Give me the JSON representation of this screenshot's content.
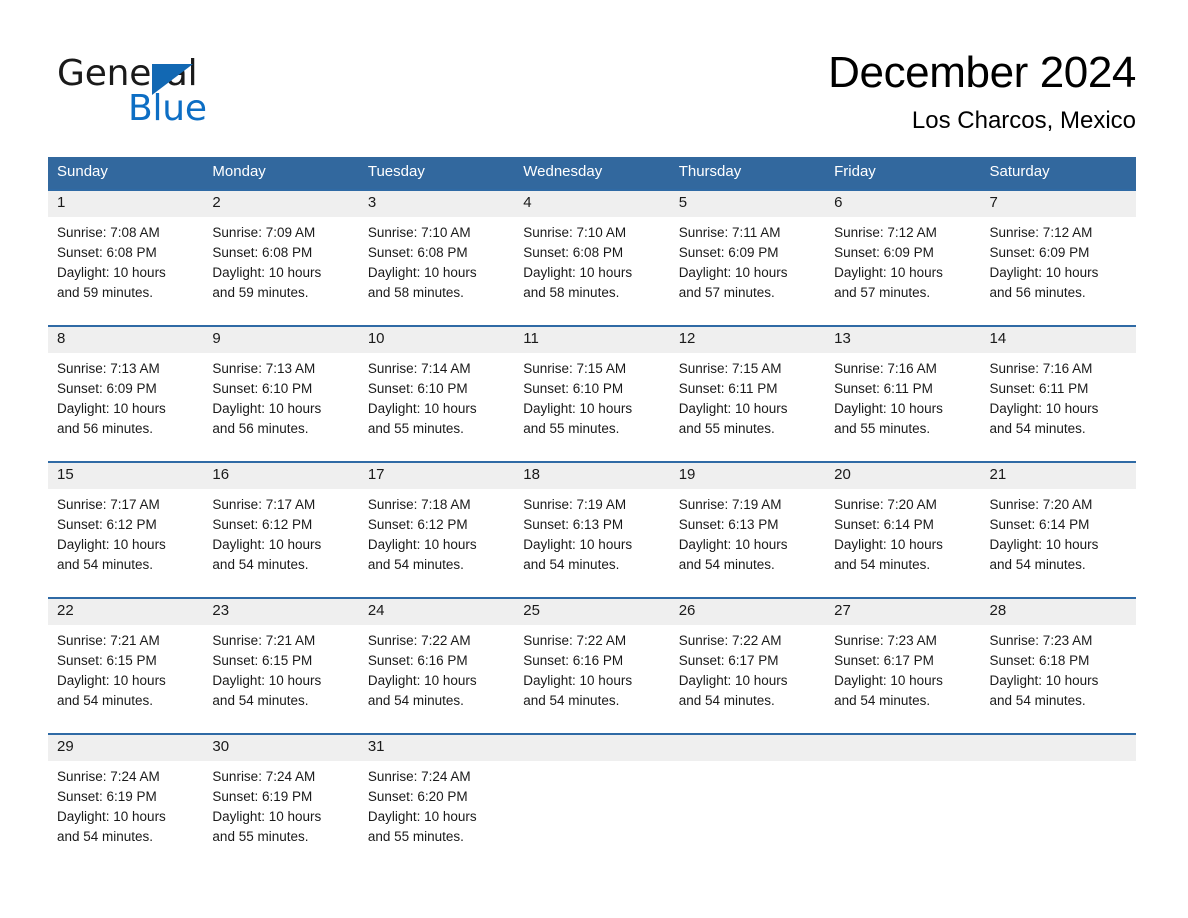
{
  "brand": {
    "name_part1": "General",
    "name_part2": "Blue",
    "triangle_color": "#1268b3",
    "blue_color": "#0d6ec4"
  },
  "header": {
    "month_title": "December 2024",
    "location": "Los Charcos, Mexico"
  },
  "theme": {
    "header_bg": "#32689e",
    "header_text": "#ffffff",
    "week_separator": "#2f6aa5",
    "day_number_bg": "#efefef",
    "cell_bg": "#ffffff",
    "text": "#1a1a1a"
  },
  "weekdays": [
    "Sunday",
    "Monday",
    "Tuesday",
    "Wednesday",
    "Thursday",
    "Friday",
    "Saturday"
  ],
  "weeks": [
    {
      "numbers": [
        "1",
        "2",
        "3",
        "4",
        "5",
        "6",
        "7"
      ],
      "days": [
        {
          "sunrise": "Sunrise: 7:08 AM",
          "sunset": "Sunset: 6:08 PM",
          "daylight1": "Daylight: 10 hours",
          "daylight2": "and 59 minutes."
        },
        {
          "sunrise": "Sunrise: 7:09 AM",
          "sunset": "Sunset: 6:08 PM",
          "daylight1": "Daylight: 10 hours",
          "daylight2": "and 59 minutes."
        },
        {
          "sunrise": "Sunrise: 7:10 AM",
          "sunset": "Sunset: 6:08 PM",
          "daylight1": "Daylight: 10 hours",
          "daylight2": "and 58 minutes."
        },
        {
          "sunrise": "Sunrise: 7:10 AM",
          "sunset": "Sunset: 6:08 PM",
          "daylight1": "Daylight: 10 hours",
          "daylight2": "and 58 minutes."
        },
        {
          "sunrise": "Sunrise: 7:11 AM",
          "sunset": "Sunset: 6:09 PM",
          "daylight1": "Daylight: 10 hours",
          "daylight2": "and 57 minutes."
        },
        {
          "sunrise": "Sunrise: 7:12 AM",
          "sunset": "Sunset: 6:09 PM",
          "daylight1": "Daylight: 10 hours",
          "daylight2": "and 57 minutes."
        },
        {
          "sunrise": "Sunrise: 7:12 AM",
          "sunset": "Sunset: 6:09 PM",
          "daylight1": "Daylight: 10 hours",
          "daylight2": "and 56 minutes."
        }
      ]
    },
    {
      "numbers": [
        "8",
        "9",
        "10",
        "11",
        "12",
        "13",
        "14"
      ],
      "days": [
        {
          "sunrise": "Sunrise: 7:13 AM",
          "sunset": "Sunset: 6:09 PM",
          "daylight1": "Daylight: 10 hours",
          "daylight2": "and 56 minutes."
        },
        {
          "sunrise": "Sunrise: 7:13 AM",
          "sunset": "Sunset: 6:10 PM",
          "daylight1": "Daylight: 10 hours",
          "daylight2": "and 56 minutes."
        },
        {
          "sunrise": "Sunrise: 7:14 AM",
          "sunset": "Sunset: 6:10 PM",
          "daylight1": "Daylight: 10 hours",
          "daylight2": "and 55 minutes."
        },
        {
          "sunrise": "Sunrise: 7:15 AM",
          "sunset": "Sunset: 6:10 PM",
          "daylight1": "Daylight: 10 hours",
          "daylight2": "and 55 minutes."
        },
        {
          "sunrise": "Sunrise: 7:15 AM",
          "sunset": "Sunset: 6:11 PM",
          "daylight1": "Daylight: 10 hours",
          "daylight2": "and 55 minutes."
        },
        {
          "sunrise": "Sunrise: 7:16 AM",
          "sunset": "Sunset: 6:11 PM",
          "daylight1": "Daylight: 10 hours",
          "daylight2": "and 55 minutes."
        },
        {
          "sunrise": "Sunrise: 7:16 AM",
          "sunset": "Sunset: 6:11 PM",
          "daylight1": "Daylight: 10 hours",
          "daylight2": "and 54 minutes."
        }
      ]
    },
    {
      "numbers": [
        "15",
        "16",
        "17",
        "18",
        "19",
        "20",
        "21"
      ],
      "days": [
        {
          "sunrise": "Sunrise: 7:17 AM",
          "sunset": "Sunset: 6:12 PM",
          "daylight1": "Daylight: 10 hours",
          "daylight2": "and 54 minutes."
        },
        {
          "sunrise": "Sunrise: 7:17 AM",
          "sunset": "Sunset: 6:12 PM",
          "daylight1": "Daylight: 10 hours",
          "daylight2": "and 54 minutes."
        },
        {
          "sunrise": "Sunrise: 7:18 AM",
          "sunset": "Sunset: 6:12 PM",
          "daylight1": "Daylight: 10 hours",
          "daylight2": "and 54 minutes."
        },
        {
          "sunrise": "Sunrise: 7:19 AM",
          "sunset": "Sunset: 6:13 PM",
          "daylight1": "Daylight: 10 hours",
          "daylight2": "and 54 minutes."
        },
        {
          "sunrise": "Sunrise: 7:19 AM",
          "sunset": "Sunset: 6:13 PM",
          "daylight1": "Daylight: 10 hours",
          "daylight2": "and 54 minutes."
        },
        {
          "sunrise": "Sunrise: 7:20 AM",
          "sunset": "Sunset: 6:14 PM",
          "daylight1": "Daylight: 10 hours",
          "daylight2": "and 54 minutes."
        },
        {
          "sunrise": "Sunrise: 7:20 AM",
          "sunset": "Sunset: 6:14 PM",
          "daylight1": "Daylight: 10 hours",
          "daylight2": "and 54 minutes."
        }
      ]
    },
    {
      "numbers": [
        "22",
        "23",
        "24",
        "25",
        "26",
        "27",
        "28"
      ],
      "days": [
        {
          "sunrise": "Sunrise: 7:21 AM",
          "sunset": "Sunset: 6:15 PM",
          "daylight1": "Daylight: 10 hours",
          "daylight2": "and 54 minutes."
        },
        {
          "sunrise": "Sunrise: 7:21 AM",
          "sunset": "Sunset: 6:15 PM",
          "daylight1": "Daylight: 10 hours",
          "daylight2": "and 54 minutes."
        },
        {
          "sunrise": "Sunrise: 7:22 AM",
          "sunset": "Sunset: 6:16 PM",
          "daylight1": "Daylight: 10 hours",
          "daylight2": "and 54 minutes."
        },
        {
          "sunrise": "Sunrise: 7:22 AM",
          "sunset": "Sunset: 6:16 PM",
          "daylight1": "Daylight: 10 hours",
          "daylight2": "and 54 minutes."
        },
        {
          "sunrise": "Sunrise: 7:22 AM",
          "sunset": "Sunset: 6:17 PM",
          "daylight1": "Daylight: 10 hours",
          "daylight2": "and 54 minutes."
        },
        {
          "sunrise": "Sunrise: 7:23 AM",
          "sunset": "Sunset: 6:17 PM",
          "daylight1": "Daylight: 10 hours",
          "daylight2": "and 54 minutes."
        },
        {
          "sunrise": "Sunrise: 7:23 AM",
          "sunset": "Sunset: 6:18 PM",
          "daylight1": "Daylight: 10 hours",
          "daylight2": "and 54 minutes."
        }
      ]
    },
    {
      "numbers": [
        "29",
        "30",
        "31",
        "",
        "",
        "",
        ""
      ],
      "days": [
        {
          "sunrise": "Sunrise: 7:24 AM",
          "sunset": "Sunset: 6:19 PM",
          "daylight1": "Daylight: 10 hours",
          "daylight2": "and 54 minutes."
        },
        {
          "sunrise": "Sunrise: 7:24 AM",
          "sunset": "Sunset: 6:19 PM",
          "daylight1": "Daylight: 10 hours",
          "daylight2": "and 55 minutes."
        },
        {
          "sunrise": "Sunrise: 7:24 AM",
          "sunset": "Sunset: 6:20 PM",
          "daylight1": "Daylight: 10 hours",
          "daylight2": "and 55 minutes."
        },
        {
          "sunrise": "",
          "sunset": "",
          "daylight1": "",
          "daylight2": ""
        },
        {
          "sunrise": "",
          "sunset": "",
          "daylight1": "",
          "daylight2": ""
        },
        {
          "sunrise": "",
          "sunset": "",
          "daylight1": "",
          "daylight2": ""
        },
        {
          "sunrise": "",
          "sunset": "",
          "daylight1": "",
          "daylight2": ""
        }
      ]
    }
  ]
}
